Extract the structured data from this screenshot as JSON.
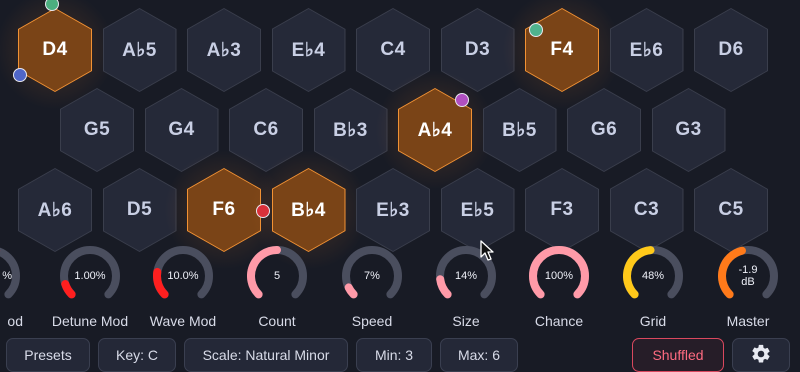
{
  "hex_rows": [
    [
      {
        "note": "D4",
        "active": true
      },
      {
        "note": "A♭5"
      },
      {
        "note": "A♭3"
      },
      {
        "note": "E♭4"
      },
      {
        "note": "C4"
      },
      {
        "note": "D3"
      },
      {
        "note": "F4",
        "active": true
      },
      {
        "note": "E♭6"
      },
      {
        "note": "D6"
      }
    ],
    [
      {
        "note": "G5"
      },
      {
        "note": "G4"
      },
      {
        "note": "C6"
      },
      {
        "note": "B♭3"
      },
      {
        "note": "A♭4",
        "active": true
      },
      {
        "note": "B♭5"
      },
      {
        "note": "G6"
      },
      {
        "note": "G3"
      }
    ],
    [
      {
        "note": "A♭6"
      },
      {
        "note": "D5"
      },
      {
        "note": "F6",
        "active": true
      },
      {
        "note": "B♭4",
        "active": true
      },
      {
        "note": "E♭3"
      },
      {
        "note": "E♭5"
      },
      {
        "note": "F3"
      },
      {
        "note": "C3"
      },
      {
        "note": "C5"
      }
    ]
  ],
  "player_dots": [
    {
      "color": "#4cae7f"
    },
    {
      "color": "#4f66c8"
    },
    {
      "color": "#4fb38e"
    },
    {
      "color": "#b04fc0"
    },
    {
      "color": "#d9313a"
    }
  ],
  "knobs": [
    {
      "value": "%",
      "label": "od",
      "level": 0.55,
      "color": "#ff1f1f"
    },
    {
      "value": "1.00%",
      "label": "Detune Mod",
      "level": 0.1,
      "color": "#ff1f1f"
    },
    {
      "value": "10.0%",
      "label": "Wave Mod",
      "level": 0.2,
      "color": "#ff1f1f"
    },
    {
      "value": "5",
      "label": "Count",
      "level": 0.5,
      "color": "#ff9aa8"
    },
    {
      "value": "7%",
      "label": "Speed",
      "level": 0.07,
      "color": "#ff9aa8"
    },
    {
      "value": "14%",
      "label": "Size",
      "level": 0.14,
      "color": "#ff9aa8"
    },
    {
      "value": "100%",
      "label": "Chance",
      "level": 1.0,
      "color": "#ff9aa8"
    },
    {
      "value": "48%",
      "label": "Grid",
      "level": 0.48,
      "color": "#ffc91a"
    },
    {
      "value": "-1.9\ndB",
      "label": "Master",
      "level": 0.45,
      "color": "#ff7a1a"
    }
  ],
  "knob_track_color": "#4a4e5e",
  "buttons": {
    "presets": "Presets",
    "key": "Key: C",
    "scale": "Scale: Natural Minor",
    "min": "Min: 3",
    "max": "Max: 6",
    "shuffled": "Shuffled"
  },
  "icons": {
    "settings": "gear-icon",
    "cursor": "pointer-cursor-icon"
  }
}
